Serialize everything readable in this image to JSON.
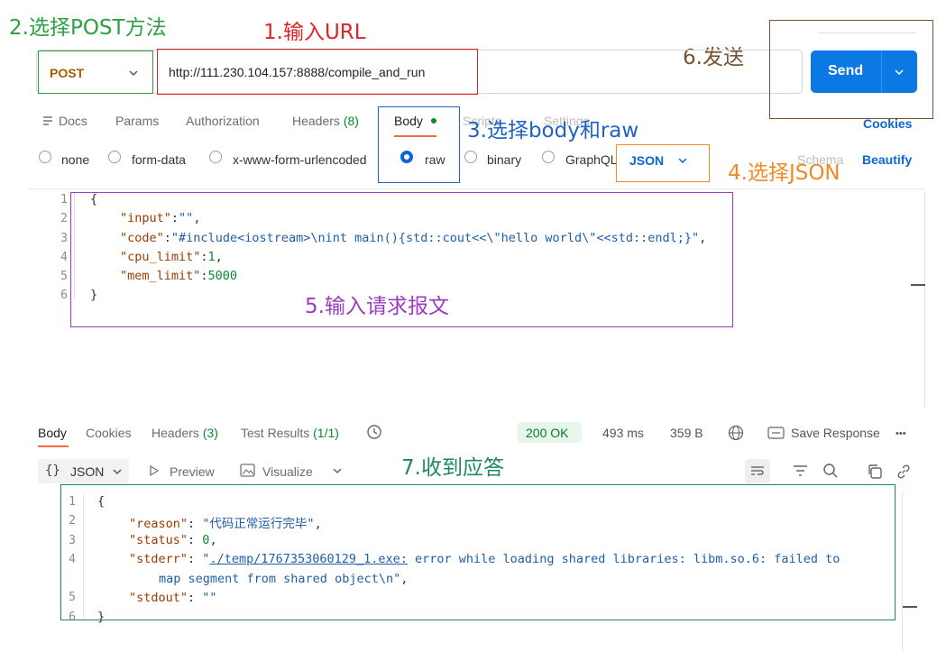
{
  "annotations": {
    "step1": "1.输入URL",
    "step2": "2.选择POST方法",
    "step3": "3.选择body和raw",
    "step4": "4.选择JSON",
    "step5": "5.输入请求报文",
    "step6": "6.发送",
    "step7": "7.收到应答",
    "colors": {
      "step1": "#e02424",
      "step2": "#2ea043",
      "step3": "#1f63c6",
      "step4": "#f08a24",
      "step5": "#9b3dbf",
      "step6": "#7a5231",
      "step7": "#1d8a5a"
    }
  },
  "request": {
    "method": "POST",
    "url": "http://111.230.104.157:8888/compile_and_run",
    "send_label": "Send",
    "tabs": {
      "docs": "Docs",
      "params": "Params",
      "authorization": "Authorization",
      "headers": "Headers",
      "headers_count": "(8)",
      "body": "Body",
      "scripts": "Scripts",
      "settings": "Settings",
      "cookies": "Cookies"
    },
    "body_types": {
      "none": "none",
      "form_data": "form-data",
      "urlencoded": "x-www-form-urlencoded",
      "raw": "raw",
      "binary": "binary",
      "graphql": "GraphQL",
      "format": "JSON",
      "schema": "Schema",
      "beautify": "Beautify"
    },
    "line_numbers": [
      "1",
      "2",
      "3",
      "4",
      "5",
      "6"
    ],
    "code": {
      "open": "{",
      "key_input": "\"input\"",
      "val_input": "\"\"",
      "key_code": "\"code\"",
      "val_code": "\"#include<iostream>\\nint main(){std::cout<<\\\"hello world\\\"<<std::endl;}\"",
      "key_cpu": "\"cpu_limit\"",
      "val_cpu": "1",
      "key_mem": "\"mem_limit\"",
      "val_mem": "5000",
      "close": "}"
    }
  },
  "response": {
    "tabs": {
      "body": "Body",
      "cookies": "Cookies",
      "headers": "Headers",
      "headers_count": "(3)",
      "tests": "Test Results",
      "tests_count": "(1/1)"
    },
    "status": "200 OK",
    "time": "493 ms",
    "size": "359 B",
    "save": "Save Response",
    "more": "•••",
    "format": "JSON",
    "format_braces": "{}",
    "preview": "Preview",
    "visualize": "Visualize",
    "line_numbers": [
      "1",
      "2",
      "3",
      "4",
      "",
      "5",
      "6"
    ],
    "code": {
      "open": "{",
      "key_reason": "\"reason\"",
      "val_reason": "\"代码正常运行完毕\"",
      "key_status": "\"status\"",
      "val_status": "0",
      "key_stderr": "\"stderr\"",
      "val_stderr_q": "\"",
      "val_stderr_path": "./temp/1767353060129_1.exe:",
      "val_stderr_rest": " error while loading shared libraries: libm.so.6: failed to",
      "val_stderr_line2": "map segment from shared object\\n\"",
      "key_stdout": "\"stdout\"",
      "val_stdout": "\"\"",
      "close": "}"
    }
  }
}
